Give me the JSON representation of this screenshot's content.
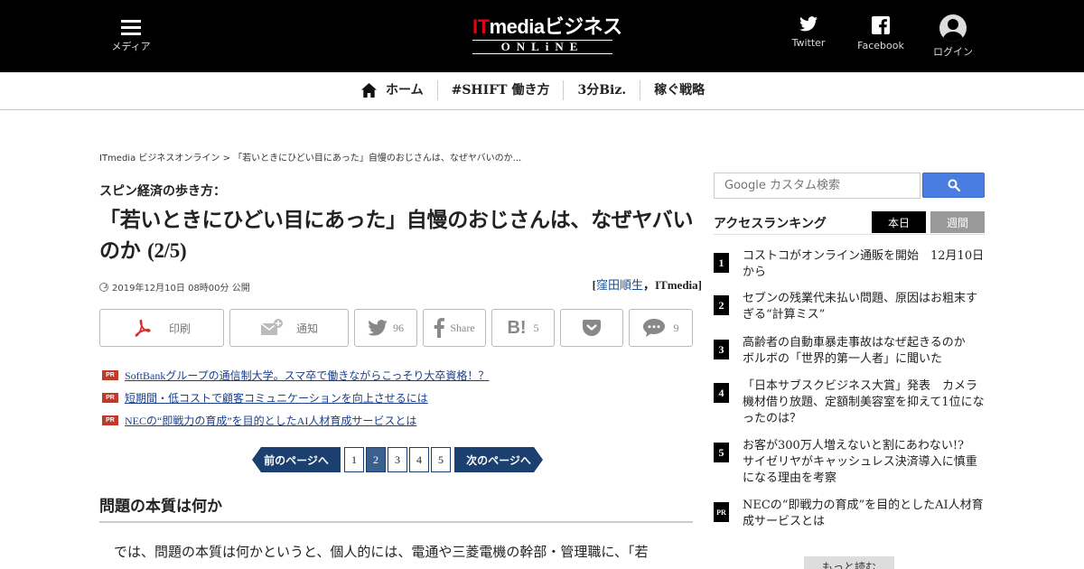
{
  "header": {
    "menu_label": "メディア",
    "logo_it": "IT",
    "logo_rest": "mediaビジネス",
    "logo_sub": "ONLiNE",
    "twitter_label": "Twitter",
    "facebook_label": "Facebook",
    "login_label": "ログイン"
  },
  "nav": {
    "items": [
      "ホーム",
      "#SHIFT 働き方",
      "3分Biz.",
      "稼ぐ戦略"
    ]
  },
  "breadcrumb": {
    "home": "ITmedia ビジネスオンライン",
    "sep": ">",
    "current": "「若いときにひどい目にあった」自慢のおじさんは、なぜヤバいのか..."
  },
  "article": {
    "series": "スピン経済の歩き方：",
    "title": "「若いときにひどい目にあった」自慢のおじさんは、なぜヤバいのか",
    "page_suffix": "(2/5)",
    "pubdate": "2019年12月10日 08時00分 公開",
    "author_open": "[",
    "author_name": "窪田順生",
    "author_sep": "，",
    "author_org": "ITmedia",
    "author_close": "]"
  },
  "share": {
    "print_label": "印刷",
    "notify_label": "通知",
    "twitter_count": "96",
    "facebook_label": "Share",
    "hatena_count": "5",
    "comment_count": "9"
  },
  "pr_links": [
    "SoftBankグループの通信制大学。スマ卒で働きながらこっそり大卒資格！？",
    "短期間・低コストで顧客コミュニケーションを向上させるには",
    "NECの“即戦力の育成”を目的としたAI人材育成サービスとは"
  ],
  "pr_badge": "PR",
  "pager": {
    "prev": "前のページへ",
    "next": "次のページへ",
    "pages": [
      "1",
      "2",
      "3",
      "4",
      "5"
    ],
    "current": "2"
  },
  "section": {
    "heading": "問題の本質は何か",
    "paragraph": "では、問題の本質は何かというと、個人的には、電通や三菱電機の幹部・管理職に、「若"
  },
  "sidebar": {
    "search_placeholder": "Google カスタム検索",
    "ranking_title": "アクセスランキング",
    "tab_today": "本日",
    "tab_week": "週間",
    "ranking": [
      {
        "rank": "1",
        "text": "コストコがオンライン通販を開始　12月10日から"
      },
      {
        "rank": "2",
        "text": "セブンの残業代未払い問題、原因はお粗末すぎる“計算ミス”"
      },
      {
        "rank": "3",
        "text": "高齢者の自動車暴走事故はなぜ起きるのか　ボルボの「世界的第一人者」に聞いた"
      },
      {
        "rank": "4",
        "text": "「日本サブスクビジネス大賞」発表　カメラ機材借り放題、定額制美容室を抑えて1位になったのは？"
      },
      {
        "rank": "5",
        "text": "お客が300万人増えないと割にあわない!?　サイゼリヤがキャッシュレス決済導入に慎重になる理由を考察"
      },
      {
        "rank": "PR",
        "text": "NECの“即戦力の育成”を目的としたAI人材育成サービスとは"
      }
    ],
    "more_label": "もっと読む"
  }
}
